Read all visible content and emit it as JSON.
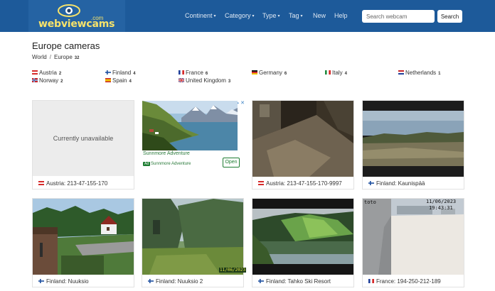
{
  "header": {
    "logo": "webviewcams",
    "logo_suffix": ".com",
    "nav": [
      {
        "label": "Continent",
        "dropdown": true
      },
      {
        "label": "Category",
        "dropdown": true
      },
      {
        "label": "Type",
        "dropdown": true
      },
      {
        "label": "Tag",
        "dropdown": true
      },
      {
        "label": "New",
        "dropdown": false
      },
      {
        "label": "Help",
        "dropdown": false
      }
    ],
    "search_placeholder": "Search webcam",
    "search_button": "Search",
    "colors": {
      "bar": "#1d5a9a",
      "logo": "#f7e36a"
    }
  },
  "page": {
    "title": "Europe cameras",
    "breadcrumb": [
      {
        "label": "World"
      },
      {
        "label": "Europe",
        "count": "32"
      }
    ]
  },
  "countries": [
    {
      "name": "Austria",
      "count": "2",
      "flag": "austria-flag-icon"
    },
    {
      "name": "Finland",
      "count": "4",
      "flag": "finland-flag-icon"
    },
    {
      "name": "France",
      "count": "6",
      "flag": "france-flag-icon"
    },
    {
      "name": "Germany",
      "count": "6",
      "flag": "germany-flag-icon"
    },
    {
      "name": "Italy",
      "count": "4",
      "flag": "italy-flag-icon"
    },
    {
      "name": "Netherlands",
      "count": "1",
      "flag": "netherlands-flag-icon"
    },
    {
      "name": "Norway",
      "count": "2",
      "flag": "norway-flag-icon"
    },
    {
      "name": "Spain",
      "count": "4",
      "flag": "spain-flag-icon"
    },
    {
      "name": "United Kingdom",
      "count": "3",
      "flag": "uk-flag-icon"
    }
  ],
  "cams": [
    {
      "label": "Austria: 213-47-155-170",
      "flag": "austria-flag-icon",
      "status": "Currently unavailable"
    },
    {
      "label": "Austria: 213-47-155-170-9997",
      "flag": "austria-flag-icon"
    },
    {
      "label": "Finland: Kaunispää",
      "flag": "finland-flag-icon"
    },
    {
      "label": "Finland: Nuuksio",
      "flag": "finland-flag-icon"
    },
    {
      "label": "Finland: Nuuksio 2",
      "flag": "finland-flag-icon",
      "overlay": "11/06/2023"
    },
    {
      "label": "Finland: Tahko Ski Resort",
      "flag": "finland-flag-icon"
    },
    {
      "label": "France: 194-250-212-189",
      "flag": "france-flag-icon",
      "overlay_tl": "toto",
      "overlay_date": "11/06/2023",
      "overlay_time": "19:43:31"
    }
  ],
  "ad": {
    "title": "Sunnmore Adventure",
    "badge": "Ad",
    "subtitle": "Sunnmore Adventure",
    "button": "Open"
  }
}
